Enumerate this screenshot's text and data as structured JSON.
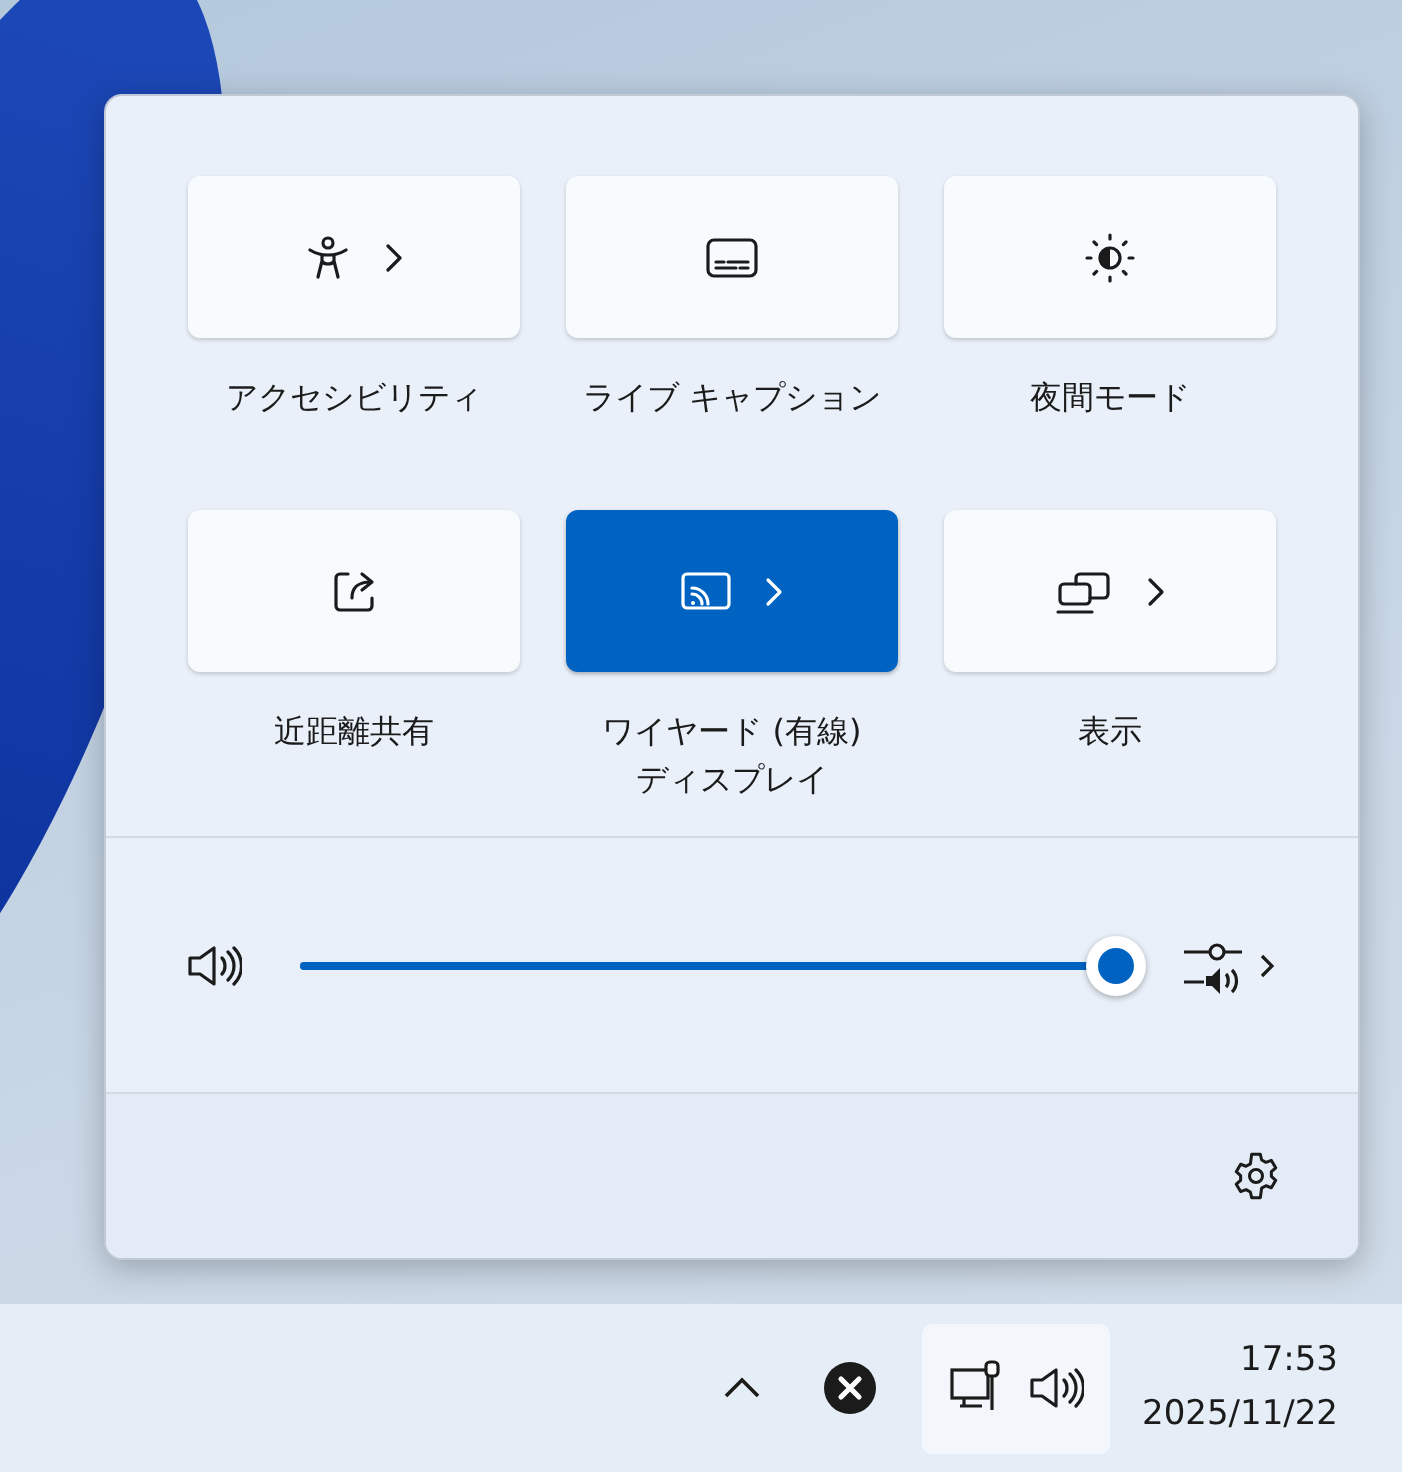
{
  "quick_settings": {
    "tiles": [
      {
        "kind": "accessibility",
        "label": "アクセシビリティ",
        "selected": false,
        "expandable": true
      },
      {
        "kind": "captions",
        "label": "ライブ キャプション",
        "selected": false,
        "expandable": false
      },
      {
        "kind": "night",
        "label": "夜間モード",
        "selected": false,
        "expandable": false
      },
      {
        "kind": "share",
        "label": "近距離共有",
        "selected": false,
        "expandable": false
      },
      {
        "kind": "cast",
        "label": "ワイヤード (有線)\nディスプレイ",
        "selected": true,
        "expandable": true
      },
      {
        "kind": "project",
        "label": "表示",
        "selected": false,
        "expandable": true
      }
    ],
    "volume": {
      "level": 0.99
    }
  },
  "taskbar": {
    "time": "17:53",
    "date": "2025/11/22"
  }
}
